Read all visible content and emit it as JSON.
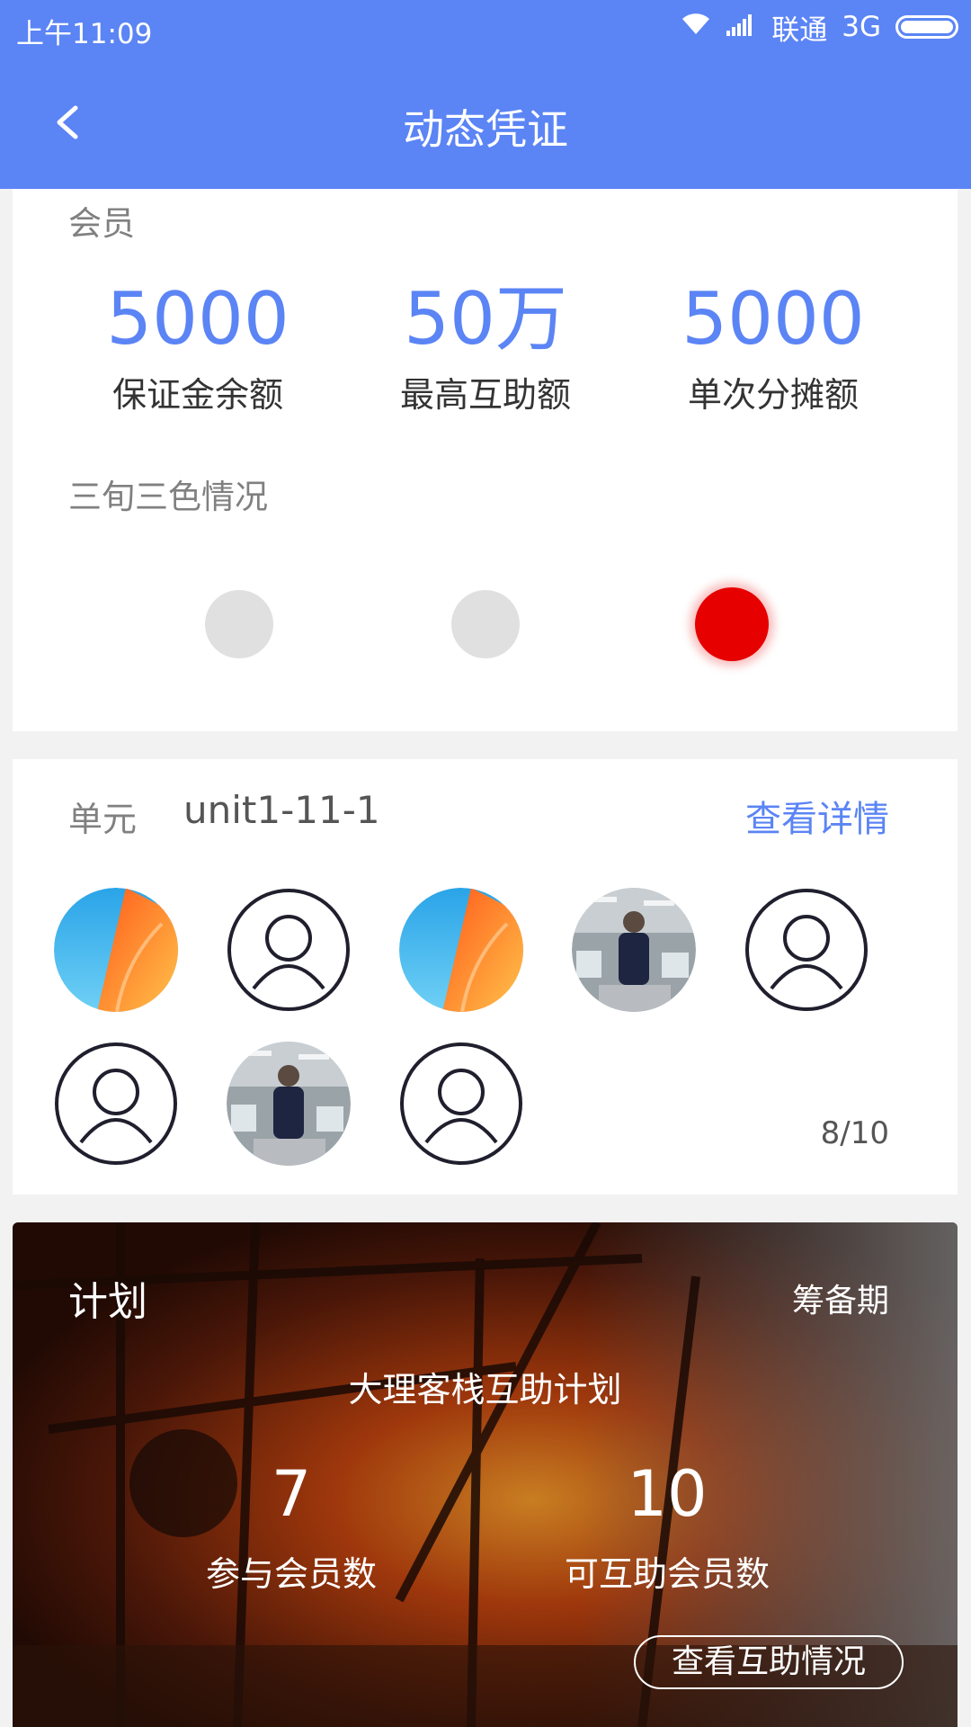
{
  "status_bar": {
    "time": "上午11:09",
    "carrier": "联通",
    "network": "3G"
  },
  "header": {
    "title": "动态凭证"
  },
  "member": {
    "section_label": "会员",
    "stats": [
      {
        "value": "5000",
        "label": "保证金余额"
      },
      {
        "value": "50万",
        "label": "最高互助额"
      },
      {
        "value": "5000",
        "label": "单次分摊额"
      }
    ],
    "three_color_label": "三旬三色情况",
    "three_color_states": [
      "grey",
      "grey",
      "red"
    ]
  },
  "unit": {
    "label": "单元",
    "value": "unit1-11-1",
    "detail_link": "查看详情",
    "count": "8/10",
    "avatars": [
      "app-logo",
      "default",
      "app-logo",
      "photo",
      "default",
      "default",
      "photo",
      "default"
    ]
  },
  "plan": {
    "label": "计划",
    "status": "筹备期",
    "name": "大理客栈互助计划",
    "participants": {
      "value": "7",
      "label": "参与会员数"
    },
    "eligible": {
      "value": "10",
      "label": "可互助会员数"
    },
    "view_button": "查看互助情况"
  },
  "colors": {
    "accent": "#5b84f5",
    "red": "#e60000",
    "grey_dot": "#e0e0e0"
  }
}
